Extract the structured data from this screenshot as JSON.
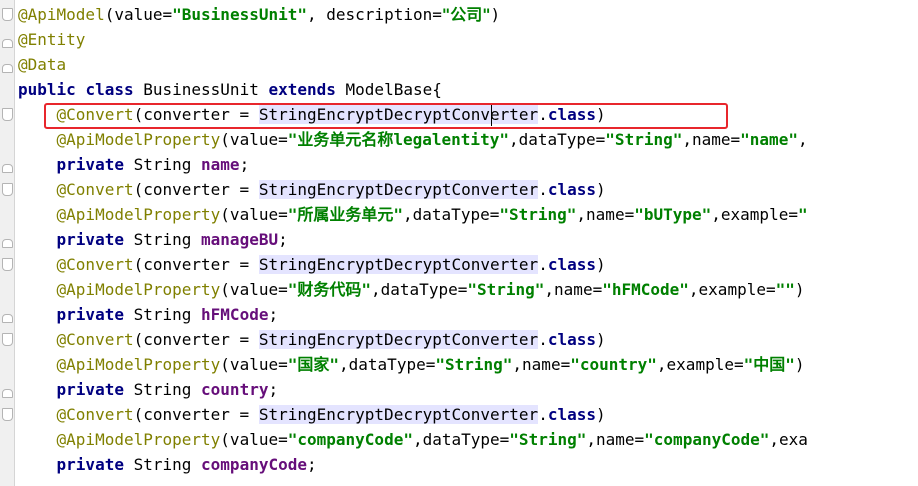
{
  "editor": {
    "lines": [
      {
        "segments": [
          {
            "t": "@ApiModel",
            "c": "ann"
          },
          {
            "t": "(value=",
            "c": "plain"
          },
          {
            "t": "\"BusinessUnit\"",
            "c": "str"
          },
          {
            "t": ", description=",
            "c": "plain"
          },
          {
            "t": "\"公司\"",
            "c": "str cjk"
          },
          {
            "t": ")",
            "c": "plain"
          }
        ]
      },
      {
        "segments": [
          {
            "t": "@Entity",
            "c": "ann"
          }
        ]
      },
      {
        "segments": [
          {
            "t": "@Data",
            "c": "ann"
          }
        ]
      },
      {
        "segments": [
          {
            "t": "public ",
            "c": "kw"
          },
          {
            "t": "class ",
            "c": "kw"
          },
          {
            "t": "BusinessUnit ",
            "c": "plain"
          },
          {
            "t": "extends ",
            "c": "kw"
          },
          {
            "t": "ModelBase{",
            "c": "plain"
          }
        ]
      },
      {
        "segments": [
          {
            "t": "    "
          },
          {
            "t": "@Convert",
            "c": "ann"
          },
          {
            "t": "(converter = ",
            "c": "plain"
          },
          {
            "t": "StringEncryptDecryptConverter",
            "c": "plain hl"
          },
          {
            "t": ".",
            "c": "plain"
          },
          {
            "t": "class",
            "c": "kw"
          },
          {
            "t": ")",
            "c": "plain"
          }
        ]
      },
      {
        "segments": [
          {
            "t": "    "
          },
          {
            "t": "@ApiModelProperty",
            "c": "ann"
          },
          {
            "t": "(value=",
            "c": "plain"
          },
          {
            "t": "\"业务单元名称legalentity\"",
            "c": "str"
          },
          {
            "t": ",dataType=",
            "c": "plain"
          },
          {
            "t": "\"String\"",
            "c": "str"
          },
          {
            "t": ",name=",
            "c": "plain"
          },
          {
            "t": "\"name\"",
            "c": "str"
          },
          {
            "t": ",",
            "c": "plain"
          }
        ]
      },
      {
        "segments": [
          {
            "t": "    "
          },
          {
            "t": "private ",
            "c": "kw"
          },
          {
            "t": "String ",
            "c": "plain"
          },
          {
            "t": "name",
            "c": "fld"
          },
          {
            "t": ";",
            "c": "plain"
          }
        ]
      },
      {
        "segments": [
          {
            "t": "    "
          },
          {
            "t": "@Convert",
            "c": "ann"
          },
          {
            "t": "(converter = ",
            "c": "plain"
          },
          {
            "t": "StringEncryptDecryptConverter",
            "c": "plain hl"
          },
          {
            "t": ".",
            "c": "plain"
          },
          {
            "t": "class",
            "c": "kw"
          },
          {
            "t": ")",
            "c": "plain"
          }
        ]
      },
      {
        "segments": [
          {
            "t": "    "
          },
          {
            "t": "@ApiModelProperty",
            "c": "ann"
          },
          {
            "t": "(value=",
            "c": "plain"
          },
          {
            "t": "\"所属业务单元\"",
            "c": "str"
          },
          {
            "t": ",dataType=",
            "c": "plain"
          },
          {
            "t": "\"String\"",
            "c": "str"
          },
          {
            "t": ",name=",
            "c": "plain"
          },
          {
            "t": "\"bUType\"",
            "c": "str"
          },
          {
            "t": ",example=",
            "c": "plain"
          },
          {
            "t": "\"",
            "c": "str"
          }
        ]
      },
      {
        "segments": [
          {
            "t": "    "
          },
          {
            "t": "private ",
            "c": "kw"
          },
          {
            "t": "String ",
            "c": "plain"
          },
          {
            "t": "manageBU",
            "c": "fld"
          },
          {
            "t": ";",
            "c": "plain"
          }
        ]
      },
      {
        "segments": [
          {
            "t": "    "
          },
          {
            "t": "@Convert",
            "c": "ann"
          },
          {
            "t": "(converter = ",
            "c": "plain"
          },
          {
            "t": "StringEncryptDecryptConverter",
            "c": "plain hl"
          },
          {
            "t": ".",
            "c": "plain"
          },
          {
            "t": "class",
            "c": "kw"
          },
          {
            "t": ")",
            "c": "plain"
          }
        ]
      },
      {
        "segments": [
          {
            "t": "    "
          },
          {
            "t": "@ApiModelProperty",
            "c": "ann"
          },
          {
            "t": "(value=",
            "c": "plain"
          },
          {
            "t": "\"财务代码\"",
            "c": "str"
          },
          {
            "t": ",dataType=",
            "c": "plain"
          },
          {
            "t": "\"String\"",
            "c": "str"
          },
          {
            "t": ",name=",
            "c": "plain"
          },
          {
            "t": "\"hFMCode\"",
            "c": "str"
          },
          {
            "t": ",example=",
            "c": "plain"
          },
          {
            "t": "\"\"",
            "c": "str"
          },
          {
            "t": ")",
            "c": "plain"
          }
        ]
      },
      {
        "segments": [
          {
            "t": "    "
          },
          {
            "t": "private ",
            "c": "kw"
          },
          {
            "t": "String ",
            "c": "plain"
          },
          {
            "t": "hFMCode",
            "c": "fld"
          },
          {
            "t": ";",
            "c": "plain"
          }
        ]
      },
      {
        "segments": [
          {
            "t": "    "
          },
          {
            "t": "@Convert",
            "c": "ann"
          },
          {
            "t": "(converter = ",
            "c": "plain"
          },
          {
            "t": "StringEncryptDecryptConverter",
            "c": "plain hl"
          },
          {
            "t": ".",
            "c": "plain"
          },
          {
            "t": "class",
            "c": "kw"
          },
          {
            "t": ")",
            "c": "plain"
          }
        ]
      },
      {
        "segments": [
          {
            "t": "    "
          },
          {
            "t": "@ApiModelProperty",
            "c": "ann"
          },
          {
            "t": "(value=",
            "c": "plain"
          },
          {
            "t": "\"国家\"",
            "c": "str"
          },
          {
            "t": ",dataType=",
            "c": "plain"
          },
          {
            "t": "\"String\"",
            "c": "str"
          },
          {
            "t": ",name=",
            "c": "plain"
          },
          {
            "t": "\"country\"",
            "c": "str"
          },
          {
            "t": ",example=",
            "c": "plain"
          },
          {
            "t": "\"中国\"",
            "c": "str"
          },
          {
            "t": ")",
            "c": "plain"
          }
        ]
      },
      {
        "segments": [
          {
            "t": "    "
          },
          {
            "t": "private ",
            "c": "kw"
          },
          {
            "t": "String ",
            "c": "plain"
          },
          {
            "t": "country",
            "c": "fld"
          },
          {
            "t": ";",
            "c": "plain"
          }
        ]
      },
      {
        "segments": [
          {
            "t": "    "
          },
          {
            "t": "@Convert",
            "c": "ann"
          },
          {
            "t": "(converter = ",
            "c": "plain"
          },
          {
            "t": "StringEncryptDecryptConverter",
            "c": "plain hl"
          },
          {
            "t": ".",
            "c": "plain"
          },
          {
            "t": "class",
            "c": "kw"
          },
          {
            "t": ")",
            "c": "plain"
          }
        ]
      },
      {
        "segments": [
          {
            "t": "    "
          },
          {
            "t": "@ApiModelProperty",
            "c": "ann"
          },
          {
            "t": "(value=",
            "c": "plain"
          },
          {
            "t": "\"companyCode\"",
            "c": "str"
          },
          {
            "t": ",dataType=",
            "c": "plain"
          },
          {
            "t": "\"String\"",
            "c": "str"
          },
          {
            "t": ",name=",
            "c": "plain"
          },
          {
            "t": "\"companyCode\"",
            "c": "str"
          },
          {
            "t": ",exa",
            "c": "plain"
          }
        ]
      },
      {
        "segments": [
          {
            "t": "    "
          },
          {
            "t": "private ",
            "c": "kw"
          },
          {
            "t": "String ",
            "c": "plain"
          },
          {
            "t": "companyCode",
            "c": "fld"
          },
          {
            "t": ";",
            "c": "plain"
          }
        ]
      }
    ]
  },
  "colors": {
    "annotation": "#808000",
    "keyword": "#000080",
    "string": "#008000",
    "field": "#660e7a",
    "highlight": "#e4e4ff",
    "callout": "#e8262c"
  },
  "icons": {
    "fold_markers": "fold-marker-icon"
  }
}
